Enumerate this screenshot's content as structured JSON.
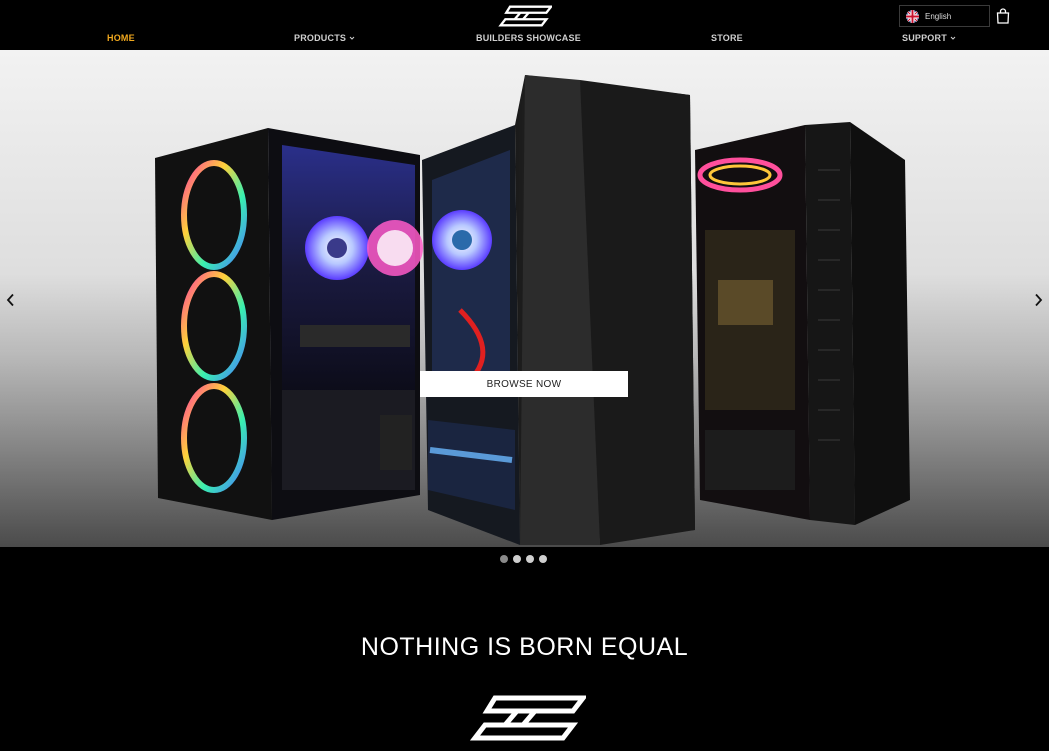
{
  "header": {
    "logo_name": "brand-logo",
    "language": {
      "label": "English",
      "flag": "uk-flag"
    },
    "cart_icon": "shopping-bag-icon"
  },
  "nav": {
    "items": [
      {
        "label": "HOME",
        "active": true,
        "has_dropdown": false
      },
      {
        "label": "PRODUCTS",
        "active": false,
        "has_dropdown": true
      },
      {
        "label": "BUILDERS SHOWCASE",
        "active": false,
        "has_dropdown": false
      },
      {
        "label": "STORE",
        "active": false,
        "has_dropdown": false
      },
      {
        "label": "SUPPORT",
        "active": false,
        "has_dropdown": true
      }
    ],
    "active_color": "#f0a81e"
  },
  "hero": {
    "button_label": "BROWSE NOW",
    "slides_count": 4,
    "active_slide": 1
  },
  "tagline": "NOTHING IS BORN EQUAL",
  "colors": {
    "background": "#000000",
    "accent": "#f0a81e",
    "text": "#ffffff"
  }
}
